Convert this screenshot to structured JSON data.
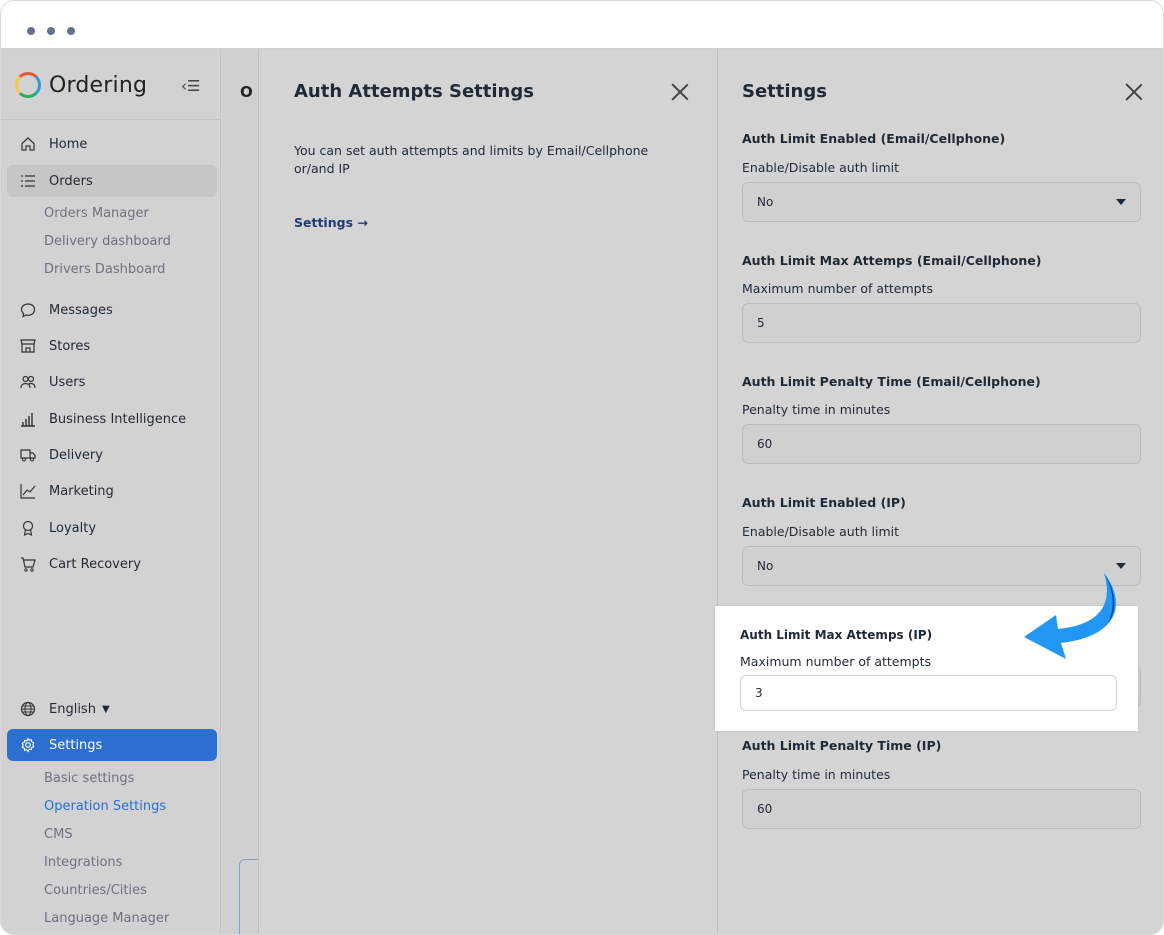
{
  "sidebar": {
    "logo_text": "Ordering",
    "nav": [
      {
        "label": "Home",
        "icon": "home-icon"
      },
      {
        "label": "Orders",
        "icon": "list-icon"
      },
      {
        "label": "Messages",
        "icon": "chat-bubble-icon"
      },
      {
        "label": "Stores",
        "icon": "store-icon"
      },
      {
        "label": "Users",
        "icon": "users-icon"
      },
      {
        "label": "Business Intelligence",
        "icon": "bar-chart-icon"
      },
      {
        "label": "Delivery",
        "icon": "truck-icon"
      },
      {
        "label": "Marketing",
        "icon": "line-chart-icon"
      },
      {
        "label": "Loyalty",
        "icon": "award-icon"
      },
      {
        "label": "Cart Recovery",
        "icon": "cart-icon"
      }
    ],
    "orders_sub": [
      "Orders Manager",
      "Delivery dashboard",
      "Drivers Dashboard"
    ],
    "language": "English",
    "settings_label": "Settings",
    "settings_sub": [
      "Basic settings",
      "Operation Settings",
      "CMS",
      "Integrations",
      "Countries/Cities",
      "Language Manager"
    ]
  },
  "bg_page": {
    "title_fragment": "O"
  },
  "auth_panel": {
    "title": "Auth Attempts Settings",
    "description": "You can set auth attempts and limits by Email/Cellphone or/and IP",
    "link": "Settings →"
  },
  "settings_panel": {
    "title": "Settings",
    "fields": [
      {
        "label": "Auth Limit Enabled (Email/Cellphone)",
        "sub": "Enable/Disable auth limit",
        "value": "No",
        "type": "select"
      },
      {
        "label": "Auth Limit Max Attemps (Email/Cellphone)",
        "sub": "Maximum number of attempts",
        "value": "5",
        "type": "input"
      },
      {
        "label": "Auth Limit Penalty Time (Email/Cellphone)",
        "sub": "Penalty time in minutes",
        "value": "60",
        "type": "input"
      },
      {
        "label": "Auth Limit Enabled (IP)",
        "sub": "Enable/Disable auth limit",
        "value": "No",
        "type": "select"
      },
      {
        "label": "Auth Limit Max Attemps (IP)",
        "sub": "Maximum number of attempts",
        "value": "3",
        "type": "input"
      },
      {
        "label": "Auth Limit Penalty Time (IP)",
        "sub": "Penalty time in minutes",
        "value": "60",
        "type": "input"
      }
    ]
  },
  "colors": {
    "accent": "#2c6fd1",
    "arrow": "#2196f3"
  }
}
